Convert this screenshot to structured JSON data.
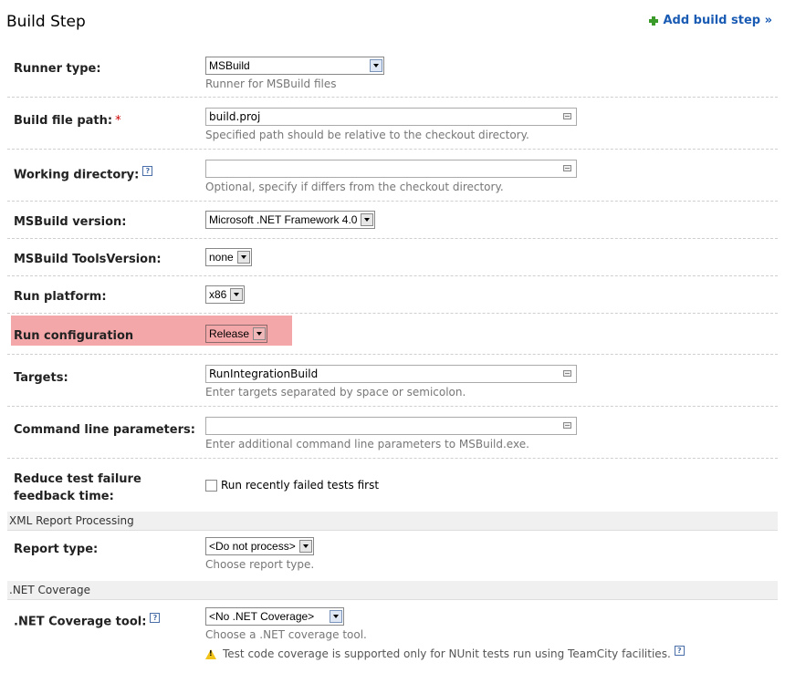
{
  "header": {
    "title": "Build Step",
    "add_step_label": "Add build step »"
  },
  "rows": {
    "runner_type": {
      "label": "Runner type:",
      "value": "MSBuild",
      "hint": "Runner for MSBuild files"
    },
    "build_file_path": {
      "label": "Build file path:",
      "required_mark": "*",
      "value": "build.proj",
      "hint": "Specified path should be relative to the checkout directory."
    },
    "working_directory": {
      "label": "Working directory:",
      "value": "",
      "hint": "Optional, specify if differs from the checkout directory."
    },
    "msbuild_version": {
      "label": "MSBuild version:",
      "value": "Microsoft .NET Framework 4.0"
    },
    "tools_version": {
      "label": "MSBuild ToolsVersion:",
      "value": "none"
    },
    "run_platform": {
      "label": "Run platform:",
      "value": "x86"
    },
    "run_configuration": {
      "label": "Run configuration",
      "value": "Release"
    },
    "targets": {
      "label": "Targets:",
      "value": "RunIntegrationBuild",
      "hint": "Enter targets separated by space or semicolon."
    },
    "cmd_params": {
      "label": "Command line parameters:",
      "value": "",
      "hint": "Enter additional command line parameters to MSBuild.exe."
    },
    "reduce_feedback": {
      "label": "Reduce test failure feedback time:",
      "checkbox_label": "Run recently failed tests first"
    }
  },
  "sections": {
    "xml_report": "XML Report Processing",
    "net_coverage": ".NET Coverage"
  },
  "report_type": {
    "label": "Report type:",
    "value": "<Do not process>",
    "hint": "Choose report type."
  },
  "coverage_tool": {
    "label": ".NET Coverage tool:",
    "value": "<No .NET Coverage>",
    "hint": "Choose a .NET coverage tool.",
    "warning": "Test code coverage is supported only for NUnit tests run using TeamCity facilities."
  },
  "colors": {
    "highlight": "#f4a7a9",
    "link": "#1a5bb3",
    "required": "#cc0000"
  }
}
